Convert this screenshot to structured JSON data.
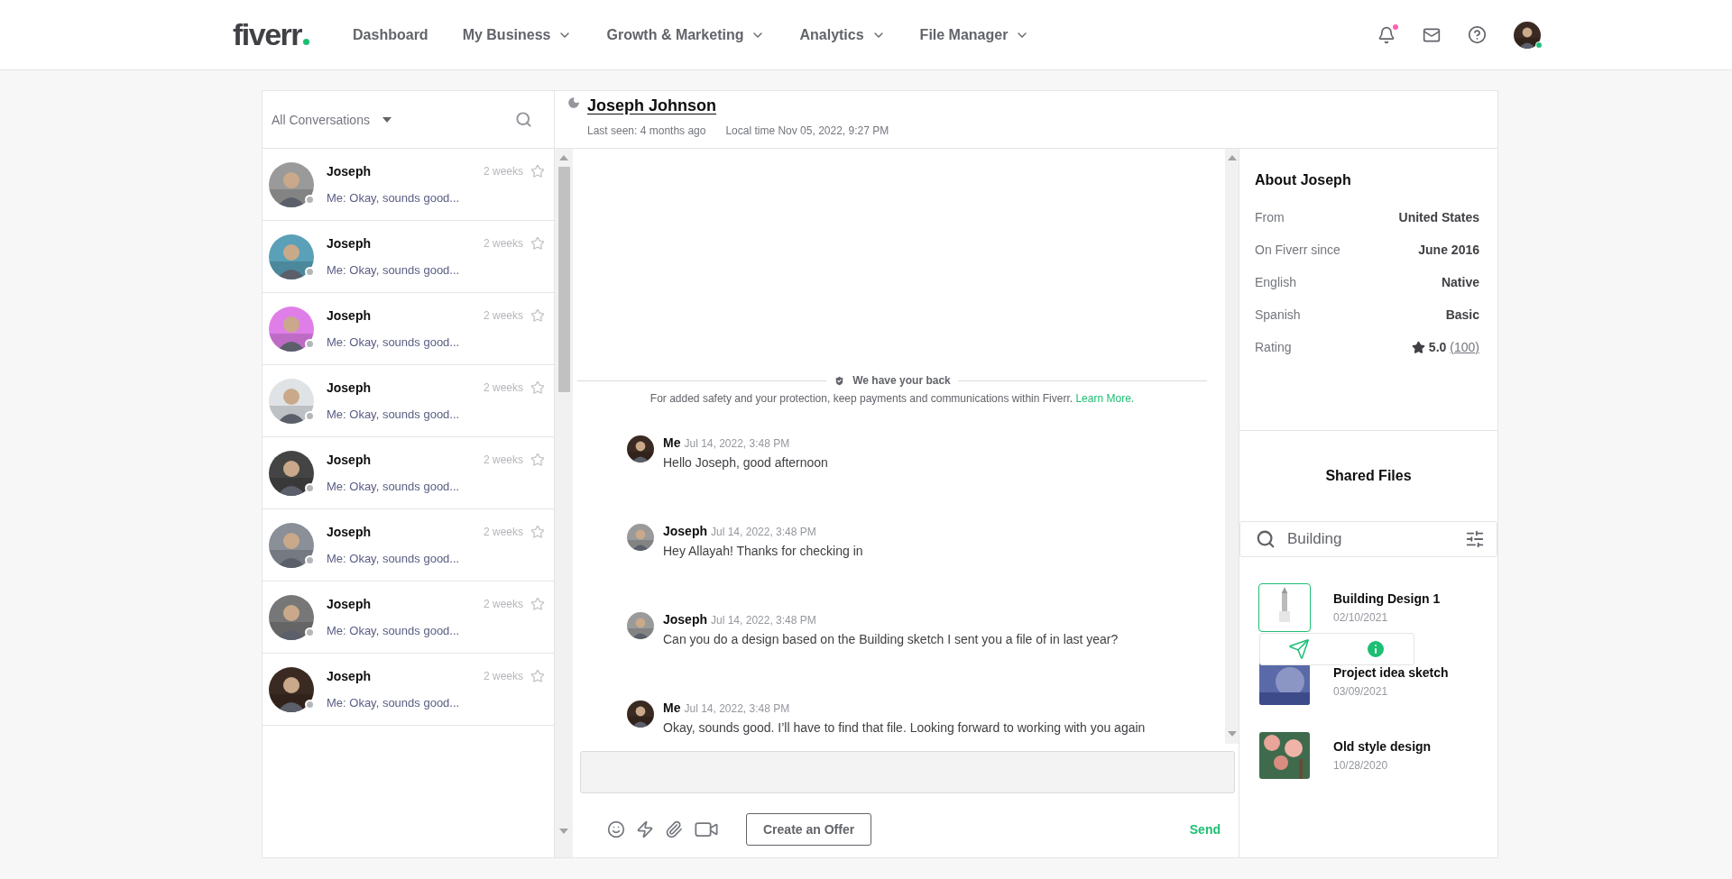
{
  "nav": {
    "logo": "fiverr",
    "items": [
      {
        "label": "Dashboard",
        "dropdown": false
      },
      {
        "label": "My Business",
        "dropdown": true
      },
      {
        "label": "Growth & Marketing",
        "dropdown": true
      },
      {
        "label": "Analytics",
        "dropdown": true
      },
      {
        "label": "File Manager",
        "dropdown": true
      }
    ],
    "notifications_unread": true,
    "user_online": true
  },
  "conversations": {
    "filter": "All Conversations",
    "items": [
      {
        "name": "Joseph",
        "time": "2 weeks",
        "preview": "Me: Okay, sounds good...",
        "online": false,
        "starred": false,
        "selected": false
      },
      {
        "name": "Joseph",
        "time": "2 weeks",
        "preview": "Me: Okay, sounds good...",
        "online": false,
        "starred": false,
        "selected": false
      },
      {
        "name": "Joseph",
        "time": "2 weeks",
        "preview": "Me: Okay, sounds good...",
        "online": false,
        "starred": false,
        "selected": false
      },
      {
        "name": "Joseph",
        "time": "2 weeks",
        "preview": "Me: Okay, sounds good...",
        "online": false,
        "starred": false,
        "selected": false
      },
      {
        "name": "Joseph",
        "time": "2 weeks",
        "preview": "Me: Okay, sounds good...",
        "online": false,
        "starred": false,
        "selected": false
      },
      {
        "name": "Joseph",
        "time": "2 weeks",
        "preview": "Me: Okay, sounds good...",
        "online": false,
        "starred": false,
        "selected": false
      },
      {
        "name": "Joseph",
        "time": "2 weeks",
        "preview": "Me: Okay, sounds good...",
        "online": false,
        "starred": false,
        "selected": false
      },
      {
        "name": "Joseph",
        "time": "2 weeks",
        "preview": "Me: Okay, sounds good...",
        "online": false,
        "starred": false,
        "selected": false
      }
    ]
  },
  "chat": {
    "name": "Joseph Johnson",
    "away": true,
    "last_seen": "Last seen: 4 months ago",
    "local_time": "Local time Nov 05, 2022, 9:27 PM",
    "notice": {
      "title": "We have your back",
      "text": "For added safety and your protection, keep payments and communications within Fiverr.",
      "link": "Learn More."
    },
    "messages": [
      {
        "kind": "me",
        "sender": "Me",
        "time": "Jul 14, 2022, 3:48 PM",
        "text": "Hello Joseph, good afternoon"
      },
      {
        "kind": "contact",
        "sender": "Joseph",
        "time": "Jul 14, 2022, 3:48 PM",
        "text": "Hey Allayah! Thanks for checking in"
      },
      {
        "kind": "contact",
        "sender": "Joseph",
        "time": "Jul 14, 2022, 3:48 PM",
        "text": "Can you do a design based on the Building sketch I sent you a file of in last year?"
      },
      {
        "kind": "me",
        "sender": "Me",
        "time": "Jul 14, 2022, 3:48 PM",
        "text": "Okay, sounds good. I’ll have to find that file. Looking forward to working with you again"
      }
    ],
    "offer_button": "Create an Offer",
    "send_button": "Send"
  },
  "about": {
    "title": "About Joseph",
    "rows": [
      {
        "kind": "text",
        "label": "From",
        "value": "United States"
      },
      {
        "kind": "text",
        "label": "On Fiverr since",
        "value": "June 2016"
      },
      {
        "kind": "text",
        "label": "English",
        "value": "Native"
      },
      {
        "kind": "text",
        "label": "Spanish",
        "value": "Basic"
      },
      {
        "kind": "rating",
        "label": "Rating",
        "value": "5.0",
        "count": "(100)"
      }
    ]
  },
  "shared_files": {
    "title": "Shared Files",
    "search": "Building",
    "files": [
      {
        "kind": "sketch",
        "name": "Building Design 1",
        "date": "02/10/2021",
        "selected": true
      },
      {
        "kind": "portrait",
        "name": "Project idea sketch",
        "date": "03/09/2021",
        "selected": false
      },
      {
        "kind": "painting",
        "name": "Old style design",
        "date": "10/28/2020",
        "selected": false
      }
    ]
  }
}
